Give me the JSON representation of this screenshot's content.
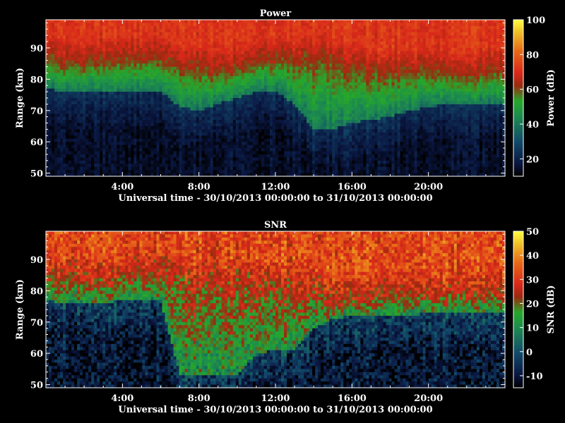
{
  "chart_data": [
    {
      "type": "heatmap",
      "title": "Power",
      "xlabel": "Universal time - 30/10/2013 00:00:00 to 31/10/2013 00:00:00",
      "ylabel": "Range (km)",
      "xlim": [
        0,
        24
      ],
      "ylim": [
        49,
        99
      ],
      "xticks": [
        "4:00",
        "8:00",
        "12:00",
        "16:00",
        "20:00"
      ],
      "yticks": [
        "50",
        "60",
        "70",
        "80",
        "90"
      ],
      "colorbar": {
        "label": "Power (dB)",
        "range": [
          10,
          100
        ],
        "ticks": [
          "20",
          "40",
          "60",
          "80",
          "100"
        ]
      },
      "layers": {
        "description_hours": [
          0,
          1,
          2,
          3,
          4,
          5,
          6,
          7,
          8,
          9,
          10,
          11,
          12,
          13,
          14,
          15,
          16,
          17,
          18,
          19,
          20,
          21,
          22,
          23,
          24
        ],
        "red_bottom_km": [
          87,
          85,
          85,
          86,
          86,
          86,
          86,
          84,
          83,
          82,
          84,
          85,
          86,
          86,
          86,
          86,
          84,
          82,
          82,
          82,
          82,
          82,
          82,
          82,
          82
        ],
        "green_bottom_km": [
          77,
          76,
          76,
          76,
          76,
          76,
          76,
          71,
          70,
          72,
          74,
          76,
          76,
          72,
          64,
          64,
          66,
          67,
          68,
          70,
          71,
          72,
          72,
          72,
          72
        ],
        "background_low_db": 15,
        "green_db": 40,
        "red_db": 62,
        "top_db": 72
      }
    },
    {
      "type": "heatmap",
      "title": "SNR",
      "xlabel": "Universal time - 30/10/2013 00:00:00 to 31/10/2013 00:00:00",
      "ylabel": "Range (km)",
      "xlim": [
        0,
        24
      ],
      "ylim": [
        49,
        99
      ],
      "xticks": [
        "4:00",
        "8:00",
        "12:00",
        "16:00",
        "20:00"
      ],
      "yticks": [
        "50",
        "60",
        "70",
        "80",
        "90"
      ],
      "colorbar": {
        "label": "SNR (dB)",
        "range": [
          -15,
          50
        ],
        "ticks": [
          "-10",
          "0",
          "10",
          "20",
          "30",
          "40",
          "50"
        ]
      },
      "layers": {
        "description_hours": [
          0,
          1,
          2,
          3,
          4,
          5,
          6,
          7,
          8,
          9,
          10,
          11,
          12,
          13,
          14,
          15,
          16,
          17,
          18,
          19,
          20,
          21,
          22,
          23,
          24
        ],
        "red_bottom_km": [
          84,
          84,
          83,
          84,
          85,
          86,
          86,
          84,
          82,
          82,
          83,
          82,
          82,
          82,
          80,
          77,
          78,
          79,
          79,
          79,
          79,
          79,
          79,
          80,
          80
        ],
        "green_bottom_km": [
          77,
          76,
          76,
          76,
          77,
          77,
          77,
          53,
          53,
          53,
          53,
          60,
          61,
          61,
          68,
          71,
          72,
          72,
          72,
          72,
          73,
          73,
          73,
          73,
          73
        ],
        "background_low_db": -10,
        "green_db": 12,
        "red_db": 25,
        "top_db": 32
      }
    }
  ]
}
